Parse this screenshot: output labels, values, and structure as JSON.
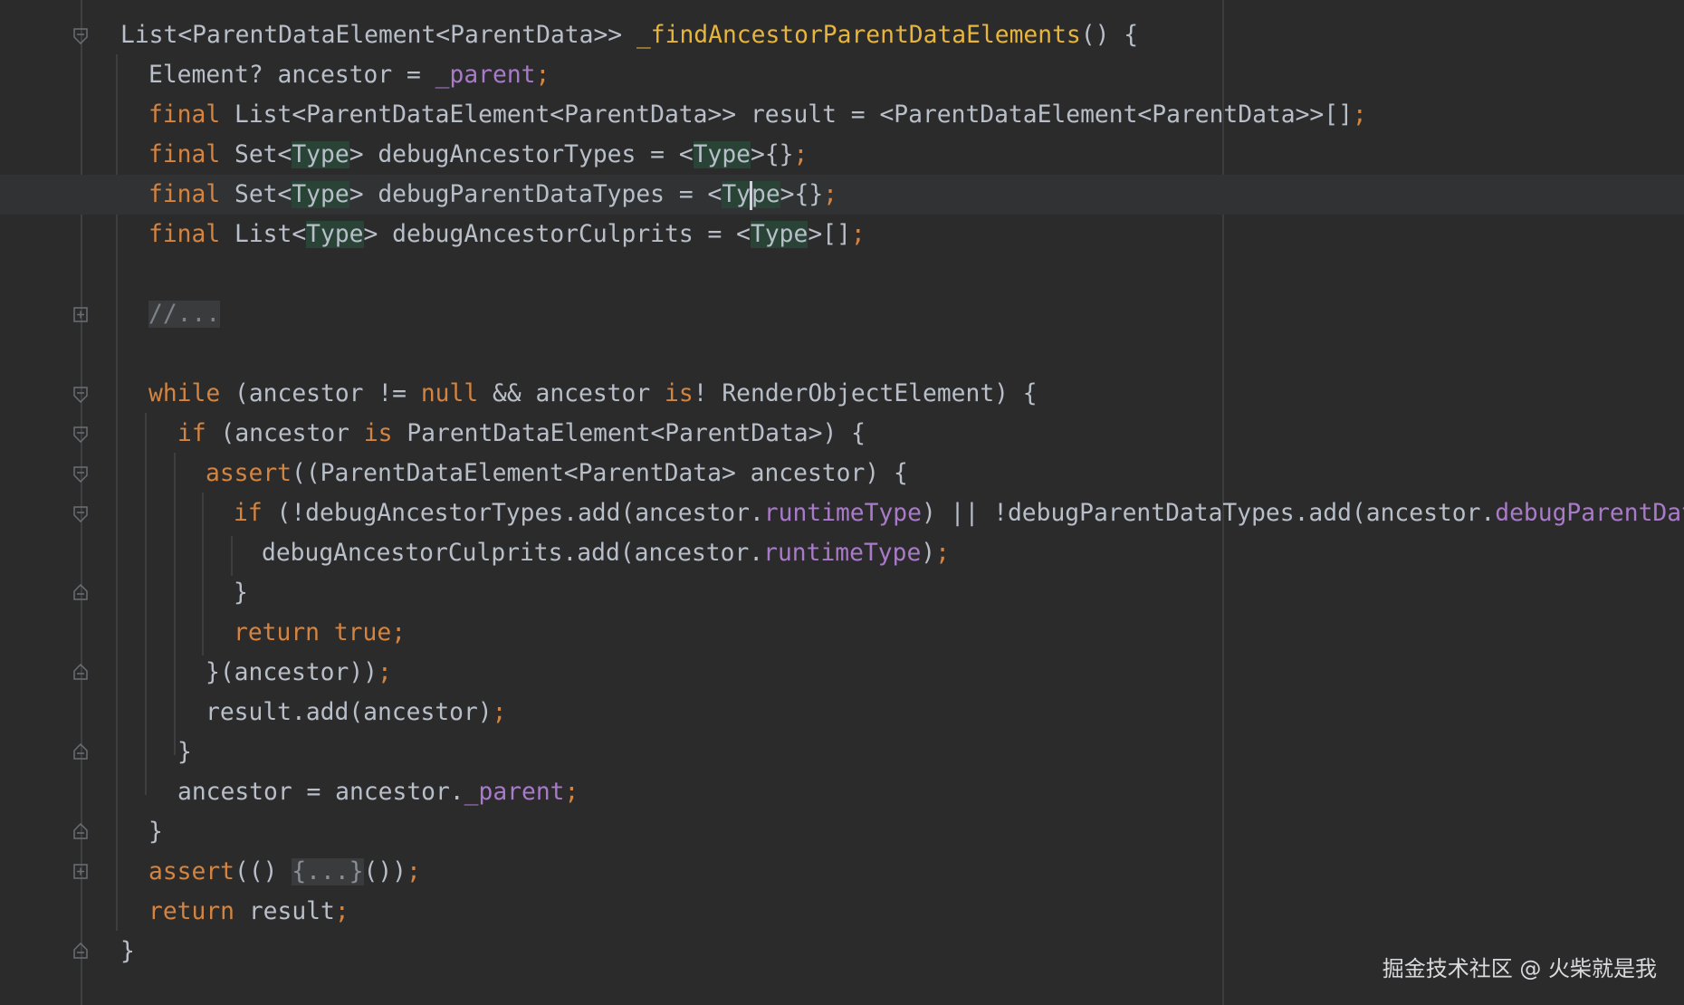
{
  "editor": {
    "theme_colors": {
      "background": "#2b2b2c",
      "keyword": "#d4843f",
      "function": "#e8b53c",
      "field": "#a97ac9",
      "text": "#b8bfc9",
      "highlight": "#294436"
    },
    "lines": {
      "l1": {
        "t1": "List<ParentDataElement<ParentData>> ",
        "t2": "_findAncestorParentDataElements",
        "t3": "() {"
      },
      "l2": {
        "t1": "Element? ancestor = ",
        "t2": "_parent",
        "t3": ";"
      },
      "l3": {
        "t1": "final",
        "t2": " List<ParentDataElement<ParentData>> result = <ParentDataElement<ParentData>>[]",
        "t3": ";"
      },
      "l4": {
        "t1": "final",
        "t2": " Set<",
        "t3": "Type",
        "t4": "> debugAncestorTypes = <",
        "t5": "Type",
        "t6": ">{}",
        "t7": ";"
      },
      "l5": {
        "t1": "final",
        "t2": " Set<",
        "t3": "Type",
        "t4": "> debugParentDataTypes = <",
        "t5a": "Ty",
        "t5b": "pe",
        "t6": ">{}",
        "t7": ";"
      },
      "l6": {
        "t1": "final",
        "t2": " List<",
        "t3": "Type",
        "t4": "> debugAncestorCulprits = <",
        "t5": "Type",
        "t6": ">[]",
        "t7": ";"
      },
      "l7": {
        "t1": "//..."
      },
      "l8": {
        "t1": "while",
        "t2": " (ancestor != ",
        "t3": "null",
        "t4": " && ancestor ",
        "t5": "is",
        "t6": "! RenderObjectElement) {"
      },
      "l9": {
        "t1": "if",
        "t2": " (ancestor ",
        "t3": "is",
        "t4": " ParentDataElement<ParentData>) {"
      },
      "l10": {
        "t1": "assert",
        "t2": "((ParentDataElement<ParentData> ancestor) {"
      },
      "l11": {
        "t1": "if",
        "t2": " (!debugAncestorTypes.add(ancestor.",
        "t3": "runtimeType",
        "t4": ") || !debugParentDataTypes.add(ancestor.",
        "t5": "debugParentDataType"
      },
      "l12": {
        "t1": "debugAncestorCulprits.add(ancestor.",
        "t2": "runtimeType",
        "t3": ")",
        "t4": ";"
      },
      "l13": {
        "t1": "}"
      },
      "l14": {
        "t1": "return",
        "t2": " ",
        "t3": "true",
        "t4": ";"
      },
      "l15": {
        "t1": "}(ancestor))",
        "t2": ";"
      },
      "l16": {
        "t1": "result.add(ancestor)",
        "t2": ";"
      },
      "l17": {
        "t1": "}"
      },
      "l18": {
        "t1": "ancestor = ancestor.",
        "t2": "_parent",
        "t3": ";"
      },
      "l19": {
        "t1": "}"
      },
      "l20": {
        "t1": "assert",
        "t2": "(() ",
        "t3": "{...}",
        "t4": "())",
        "t5": ";"
      },
      "l21": {
        "t1": "return",
        "t2": " result",
        "t3": ";"
      },
      "l22": {
        "t1": "}"
      }
    }
  },
  "watermark": {
    "text": "掘金技术社区 @ 火柴就是我"
  }
}
